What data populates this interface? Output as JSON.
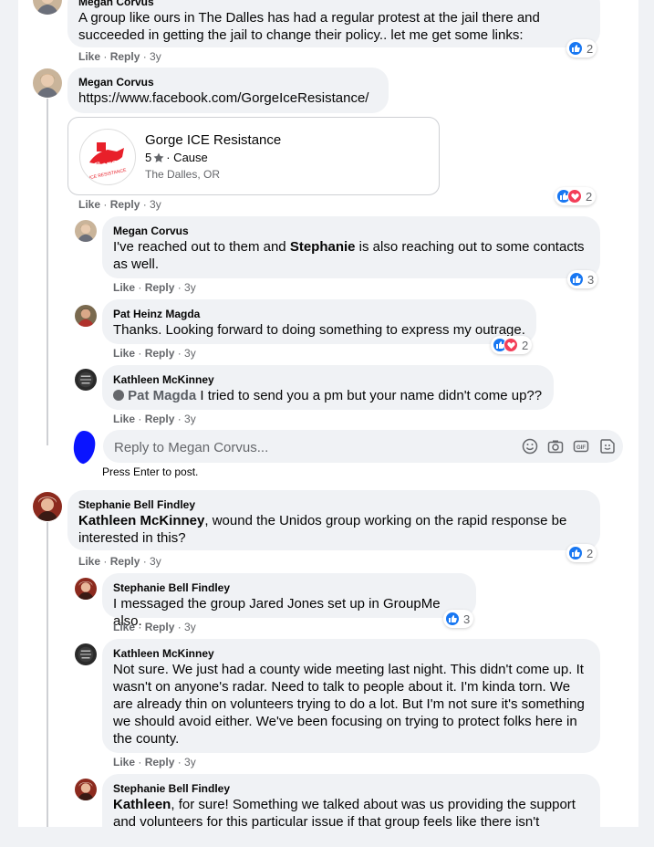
{
  "comments": [
    {
      "author": "Megan Corvus",
      "text": "A group like ours in The Dalles has had a regular protest at the jail there and succeeded in getting the jail to change their policy.. let me get some links:",
      "reactions": "2"
    },
    {
      "author": "Megan Corvus",
      "text": "https://www.facebook.com/GorgeIceResistance/",
      "reactions": "2",
      "card": {
        "title": "Gorge ICE Resistance",
        "rating": "5",
        "category": "· Cause",
        "location": "The Dalles, OR",
        "logo_text": "Gorge",
        "logo_sub": "ICE RESISTANCE"
      }
    },
    {
      "author": "Megan Corvus",
      "text_a": "I've reached out to them and ",
      "mention": "Stephanie",
      "text_b": " is also reaching out to some contacts as well.",
      "reactions": "3"
    },
    {
      "author": "Pat Heinz Magda",
      "text": "Thanks. Looking forward to doing something to express my outrage.",
      "reactions": "2"
    },
    {
      "author": "Kathleen McKinney",
      "tag": "Pat Magda",
      "text": " I tried to send you a pm but your name didn't come up??"
    },
    {
      "author": "Stephanie Bell Findley",
      "mention": "Kathleen McKinney",
      "text": ", wound the Unidos group working on the rapid response be interested in this?",
      "reactions": "2"
    },
    {
      "author": "Stephanie Bell Findley",
      "text": "I messaged the group Jared Jones set up in GroupMe also.",
      "reactions": "3"
    },
    {
      "author": "Kathleen McKinney",
      "text": "Not sure. We just had a county wide meeting last night. This didn't come up. It wasn't on anyone's radar. Need to talk to people about it. I'm kinda torn. We are already thin on volunteers trying to do a lot. But I'm not sure it's something we should avoid either. We've been focusing on trying to protect folks here in the county."
    },
    {
      "author": "Stephanie Bell Findley",
      "mention": "Kathleen",
      "text": ", for sure! Something we talked about was us providing the support and volunteers for this particular issue if that group feels like there isn't"
    }
  ],
  "actions": {
    "like": "Like",
    "sep": " · ",
    "reply": "Reply",
    "time": "3y"
  },
  "reply_box": {
    "placeholder": "Reply to Megan Corvus...",
    "hint": "Press Enter to post."
  },
  "colors": {
    "like": "#1877f2",
    "love": "#f33e58",
    "bubble": "#f0f2f5",
    "accent_avatar_blob": "#0a14ff",
    "logo_red": "#e8202a"
  }
}
